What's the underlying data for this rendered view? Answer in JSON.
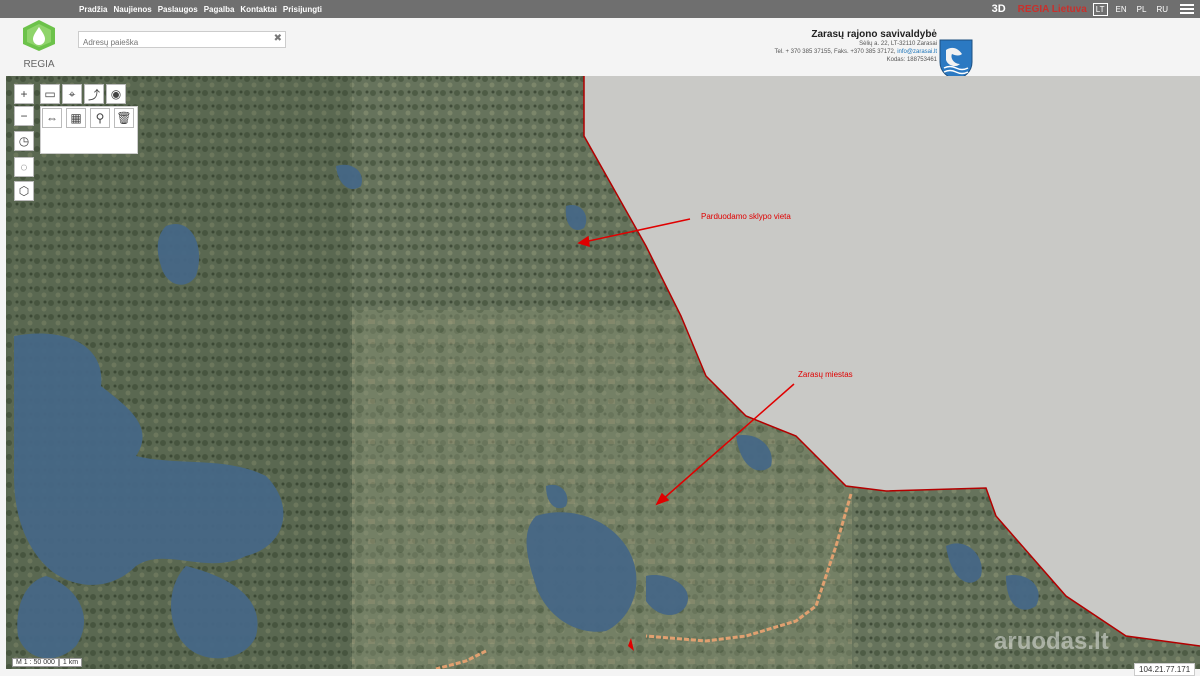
{
  "nav": {
    "items": [
      "Pradžia",
      "Naujienos",
      "Paslaugos",
      "Pagalba",
      "Kontaktai",
      "Prisijungti"
    ]
  },
  "topright": {
    "btn3d": "3D",
    "regia_label": "REGIA Lietuva",
    "languages": [
      "LT",
      "EN",
      "PL",
      "RU"
    ],
    "active_language": "LT"
  },
  "logo": {
    "text": "REGIA"
  },
  "search": {
    "placeholder": "Adresų paieška"
  },
  "municipality": {
    "name": "Zarasų rajono savivaldybė",
    "address": "Sėlių a. 22, LT-32110 Zarasai",
    "phone_prefix": "Tel. + 370 385 37155, Faks. +370 385 37172, ",
    "email": "info@zarasai.lt",
    "code": "Kodas: 188753461"
  },
  "map": {
    "annotations": {
      "plot": "Parduodamo sklypo vieta",
      "town": "Zarasų miestas"
    },
    "scale": {
      "ratio": "M 1 : 50 000",
      "bar": "1 km"
    }
  },
  "watermark": "aruodas.lt",
  "ip": "104.21.77.171",
  "colors": {
    "topbar": "#6f6f6f",
    "accent_red": "#e00000",
    "water": "#4a6b8a",
    "neighbor_country": "#c9c9c6"
  }
}
